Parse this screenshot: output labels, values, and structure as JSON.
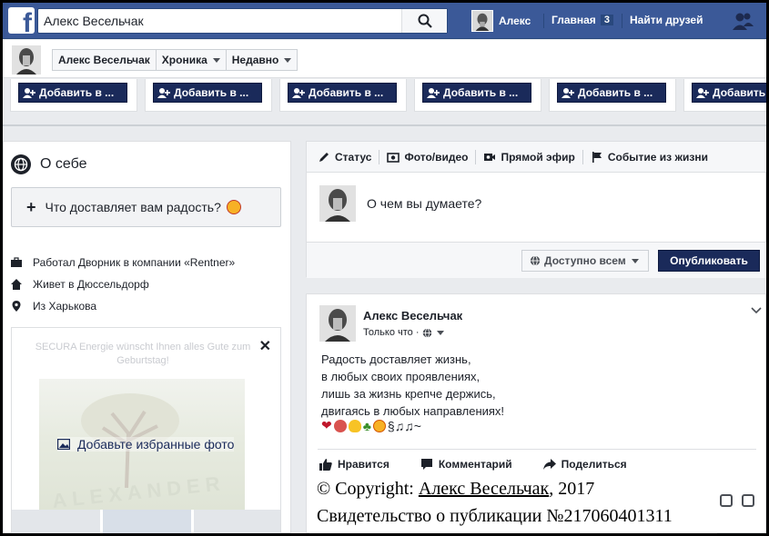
{
  "topbar": {
    "logo": "f",
    "search_value": "Алекс Весельчак",
    "search_icon": "search-icon",
    "user_name": "Алекс",
    "home_label": "Главная",
    "home_badge": "3",
    "find_friends_label": "Найти друзей",
    "friends_icon": "friends-icon"
  },
  "profile_bar": {
    "name": "Алекс Весельчак",
    "timeline": "Хроника",
    "recent": "Недавно"
  },
  "suggestions": {
    "add_labels": [
      "Добавить в ...",
      "Добавить в ...",
      "Добавить в ...",
      "Добавить в ...",
      "Добавить в ...",
      "Добавить"
    ]
  },
  "about": {
    "title": "О себе",
    "joy_prompt": "Что доставляет вам радость?",
    "work": "Работал Дворник в компании «Rentner»",
    "lives": "Живет в Дюссельдорф",
    "from": "Из Харькова",
    "photo_top_text": "SECURA Energie wünscht Ihnen alles Gute zum Geburtstag!",
    "photo_mark": "ALEXANDER",
    "add_photos": "Добавьте избранные фото"
  },
  "composer": {
    "tabs": [
      "Статус",
      "Фото/видео",
      "Прямой эфир",
      "Событие из жизни"
    ],
    "placeholder": "О чем вы думаете?",
    "audience": "Доступно всем",
    "publish": "Опубликовать"
  },
  "post": {
    "author": "Алекс Весельчак",
    "time": "Только что ·",
    "lines": [
      "Радость доставляет жизнь,",
      "в любых своих проявлениях,",
      "лишь за жизнь крепче держись,",
      "двигаясь в любых направлениях!"
    ],
    "emoji_tail": "§♫♫~",
    "actions": [
      "Нравится",
      "Комментарий",
      "Поделиться"
    ]
  },
  "copyright": {
    "prefix": "© Copyright: ",
    "author": "Алекс Весельчак",
    "year": ", 2017",
    "certificate": "Свидетельство о публикации №217060401311"
  },
  "colors": {
    "brand_blue": "#3b5998",
    "dark_button": "#1a2a5a",
    "background": "#e9ebee"
  }
}
